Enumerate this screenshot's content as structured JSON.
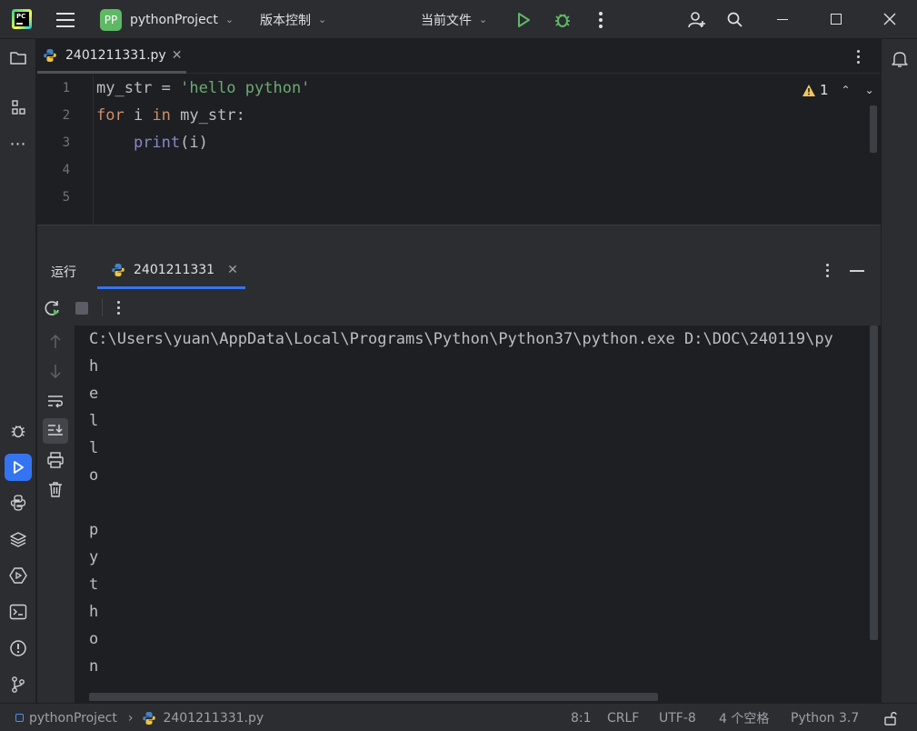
{
  "titlebar": {
    "project_badge": "PP",
    "project_name": "pythonProject",
    "vcs_label": "版本控制",
    "run_config": "当前文件"
  },
  "editor": {
    "tab_filename": "2401211331.py",
    "warning_count": "1",
    "line_numbers": [
      "1",
      "2",
      "3",
      "4",
      "5"
    ],
    "code": {
      "line1": {
        "var": "my_str = ",
        "str": "'hello python'"
      },
      "line2": {
        "kw1": "for",
        "mid1": " i ",
        "kw2": "in",
        "rest": " my_str:"
      },
      "line3": {
        "indent": "    ",
        "fn": "print",
        "rest": "(i)"
      }
    }
  },
  "run_panel": {
    "tab_run_label": "运行",
    "tab_config": "2401211331",
    "command": "C:\\Users\\yuan\\AppData\\Local\\Programs\\Python\\Python37\\python.exe D:\\DOC\\240119\\py",
    "output": [
      "h",
      "e",
      "l",
      "l",
      "o",
      " ",
      "p",
      "y",
      "t",
      "h",
      "o",
      "n"
    ]
  },
  "statusbar": {
    "project": "pythonProject",
    "file": "2401211331.py",
    "position": "8:1",
    "line_ending": "CRLF",
    "encoding": "UTF-8",
    "indent": "4 个空格",
    "interpreter": "Python 3.7"
  },
  "icons": [
    "pycharm-logo",
    "hamburger-menu-icon",
    "run-icon",
    "debug-icon",
    "more-icon",
    "add-user-icon",
    "search-icon",
    "minimize-icon",
    "maximize-icon",
    "close-icon",
    "folder-icon",
    "structure-icon",
    "bell-icon",
    "python-file-icon",
    "rerun-icon",
    "stop-icon",
    "up-arrow-icon",
    "down-arrow-icon",
    "soft-wrap-icon",
    "scroll-to-end-icon",
    "print-icon",
    "trash-icon",
    "lock-icon"
  ],
  "colors": {
    "accent": "#3574f0",
    "run_green": "#5fb865",
    "keyword": "#cf8e6d",
    "string": "#6aab73",
    "builtin": "#8888c6"
  }
}
